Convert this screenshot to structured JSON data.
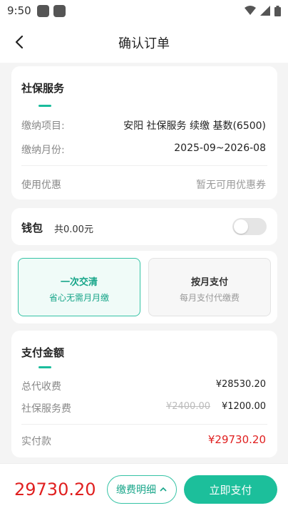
{
  "status_bar": {
    "time": "9:50"
  },
  "header": {
    "title": "确认订单"
  },
  "service_card": {
    "title": "社保服务",
    "rows": [
      {
        "label": "缴纳项目:",
        "value": "安阳 社保服务 续缴 基数(6500)"
      },
      {
        "label": "缴纳月份:",
        "value": "2025-09~2026-08"
      }
    ],
    "coupon": {
      "label": "使用优惠",
      "value": "暂无可用优惠券"
    }
  },
  "wallet": {
    "label": "钱包",
    "amount": "共0.00元",
    "enabled": false
  },
  "payment_options": [
    {
      "title": "一次交清",
      "subtitle": "省心无需月月缴",
      "selected": true
    },
    {
      "title": "按月支付",
      "subtitle": "每月支付代缴费",
      "selected": false
    }
  ],
  "amount_card": {
    "title": "支付金额",
    "total_collect": {
      "label": "总代收费",
      "value": "¥28530.20"
    },
    "service_fee": {
      "label": "社保服务费",
      "original": "¥2400.00",
      "value": "¥1200.00"
    },
    "actual": {
      "label": "实付款",
      "value": "¥29730.20"
    }
  },
  "footer": {
    "total": "29730.20",
    "detail_button": "缴费明细",
    "pay_button": "立即支付"
  },
  "colors": {
    "accent": "#1cbf9b",
    "price": "#e02020"
  }
}
